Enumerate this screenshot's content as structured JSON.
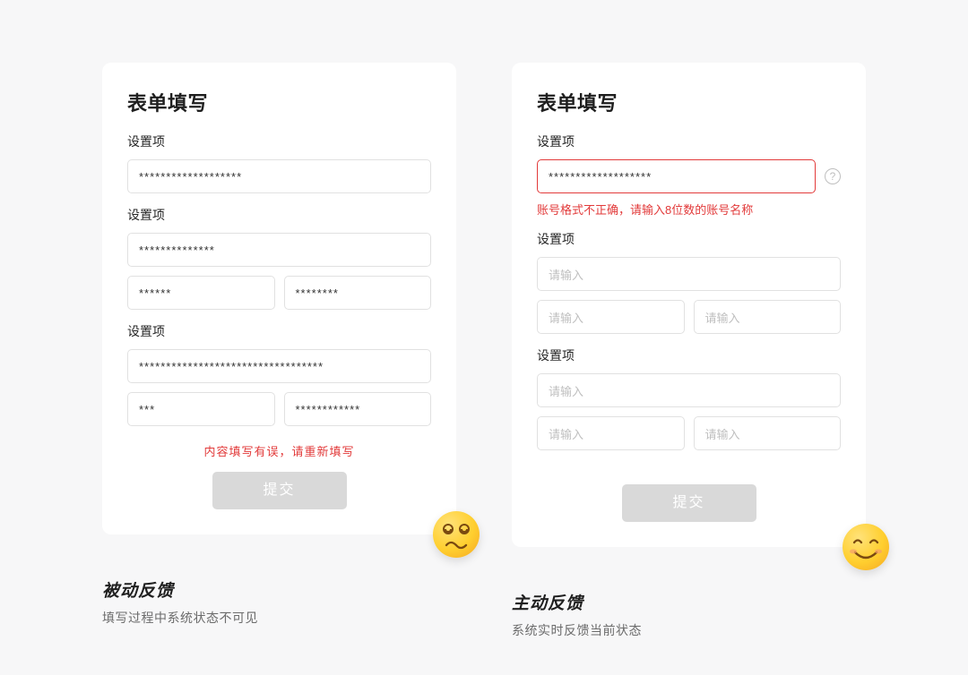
{
  "left": {
    "card_title": "表单填写",
    "section1": {
      "label": "设置项",
      "value": "*******************"
    },
    "section2": {
      "label": "设置项",
      "value": "**************",
      "sub_a": "******",
      "sub_b": "********"
    },
    "section3": {
      "label": "设置项",
      "value": "**********************************",
      "sub_a": "***",
      "sub_b": "************"
    },
    "error_text": "内容填写有误，请重新填写",
    "submit_label": "提交",
    "emoji_name": "dizzy-face",
    "caption_title": "被动反馈",
    "caption_sub": "填写过程中系统状态不可见"
  },
  "right": {
    "card_title": "表单填写",
    "section1": {
      "label": "设置项",
      "value": "*******************",
      "error_text": "账号格式不正确，请输入8位数的账号名称"
    },
    "section2": {
      "label": "设置项",
      "placeholder": "请输入",
      "sub_a_ph": "请输入",
      "sub_b_ph": "请输入"
    },
    "section3": {
      "label": "设置项",
      "placeholder": "请输入",
      "sub_a_ph": "请输入",
      "sub_b_ph": "请输入"
    },
    "submit_label": "提交",
    "emoji_name": "smile-face",
    "caption_title": "主动反馈",
    "caption_sub": "系统实时反馈当前状态"
  }
}
